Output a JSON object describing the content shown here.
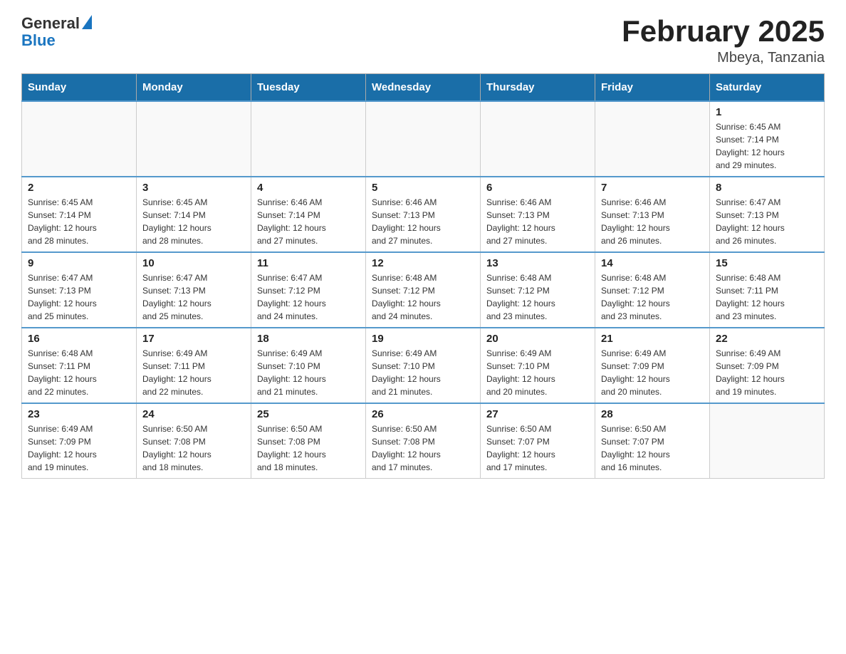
{
  "header": {
    "logo_general": "General",
    "logo_blue": "Blue",
    "month_year": "February 2025",
    "location": "Mbeya, Tanzania"
  },
  "weekdays": [
    "Sunday",
    "Monday",
    "Tuesday",
    "Wednesday",
    "Thursday",
    "Friday",
    "Saturday"
  ],
  "weeks": [
    [
      {
        "day": "",
        "info": ""
      },
      {
        "day": "",
        "info": ""
      },
      {
        "day": "",
        "info": ""
      },
      {
        "day": "",
        "info": ""
      },
      {
        "day": "",
        "info": ""
      },
      {
        "day": "",
        "info": ""
      },
      {
        "day": "1",
        "info": "Sunrise: 6:45 AM\nSunset: 7:14 PM\nDaylight: 12 hours\nand 29 minutes."
      }
    ],
    [
      {
        "day": "2",
        "info": "Sunrise: 6:45 AM\nSunset: 7:14 PM\nDaylight: 12 hours\nand 28 minutes."
      },
      {
        "day": "3",
        "info": "Sunrise: 6:45 AM\nSunset: 7:14 PM\nDaylight: 12 hours\nand 28 minutes."
      },
      {
        "day": "4",
        "info": "Sunrise: 6:46 AM\nSunset: 7:14 PM\nDaylight: 12 hours\nand 27 minutes."
      },
      {
        "day": "5",
        "info": "Sunrise: 6:46 AM\nSunset: 7:13 PM\nDaylight: 12 hours\nand 27 minutes."
      },
      {
        "day": "6",
        "info": "Sunrise: 6:46 AM\nSunset: 7:13 PM\nDaylight: 12 hours\nand 27 minutes."
      },
      {
        "day": "7",
        "info": "Sunrise: 6:46 AM\nSunset: 7:13 PM\nDaylight: 12 hours\nand 26 minutes."
      },
      {
        "day": "8",
        "info": "Sunrise: 6:47 AM\nSunset: 7:13 PM\nDaylight: 12 hours\nand 26 minutes."
      }
    ],
    [
      {
        "day": "9",
        "info": "Sunrise: 6:47 AM\nSunset: 7:13 PM\nDaylight: 12 hours\nand 25 minutes."
      },
      {
        "day": "10",
        "info": "Sunrise: 6:47 AM\nSunset: 7:13 PM\nDaylight: 12 hours\nand 25 minutes."
      },
      {
        "day": "11",
        "info": "Sunrise: 6:47 AM\nSunset: 7:12 PM\nDaylight: 12 hours\nand 24 minutes."
      },
      {
        "day": "12",
        "info": "Sunrise: 6:48 AM\nSunset: 7:12 PM\nDaylight: 12 hours\nand 24 minutes."
      },
      {
        "day": "13",
        "info": "Sunrise: 6:48 AM\nSunset: 7:12 PM\nDaylight: 12 hours\nand 23 minutes."
      },
      {
        "day": "14",
        "info": "Sunrise: 6:48 AM\nSunset: 7:12 PM\nDaylight: 12 hours\nand 23 minutes."
      },
      {
        "day": "15",
        "info": "Sunrise: 6:48 AM\nSunset: 7:11 PM\nDaylight: 12 hours\nand 23 minutes."
      }
    ],
    [
      {
        "day": "16",
        "info": "Sunrise: 6:48 AM\nSunset: 7:11 PM\nDaylight: 12 hours\nand 22 minutes."
      },
      {
        "day": "17",
        "info": "Sunrise: 6:49 AM\nSunset: 7:11 PM\nDaylight: 12 hours\nand 22 minutes."
      },
      {
        "day": "18",
        "info": "Sunrise: 6:49 AM\nSunset: 7:10 PM\nDaylight: 12 hours\nand 21 minutes."
      },
      {
        "day": "19",
        "info": "Sunrise: 6:49 AM\nSunset: 7:10 PM\nDaylight: 12 hours\nand 21 minutes."
      },
      {
        "day": "20",
        "info": "Sunrise: 6:49 AM\nSunset: 7:10 PM\nDaylight: 12 hours\nand 20 minutes."
      },
      {
        "day": "21",
        "info": "Sunrise: 6:49 AM\nSunset: 7:09 PM\nDaylight: 12 hours\nand 20 minutes."
      },
      {
        "day": "22",
        "info": "Sunrise: 6:49 AM\nSunset: 7:09 PM\nDaylight: 12 hours\nand 19 minutes."
      }
    ],
    [
      {
        "day": "23",
        "info": "Sunrise: 6:49 AM\nSunset: 7:09 PM\nDaylight: 12 hours\nand 19 minutes."
      },
      {
        "day": "24",
        "info": "Sunrise: 6:50 AM\nSunset: 7:08 PM\nDaylight: 12 hours\nand 18 minutes."
      },
      {
        "day": "25",
        "info": "Sunrise: 6:50 AM\nSunset: 7:08 PM\nDaylight: 12 hours\nand 18 minutes."
      },
      {
        "day": "26",
        "info": "Sunrise: 6:50 AM\nSunset: 7:08 PM\nDaylight: 12 hours\nand 17 minutes."
      },
      {
        "day": "27",
        "info": "Sunrise: 6:50 AM\nSunset: 7:07 PM\nDaylight: 12 hours\nand 17 minutes."
      },
      {
        "day": "28",
        "info": "Sunrise: 6:50 AM\nSunset: 7:07 PM\nDaylight: 12 hours\nand 16 minutes."
      },
      {
        "day": "",
        "info": ""
      }
    ]
  ]
}
